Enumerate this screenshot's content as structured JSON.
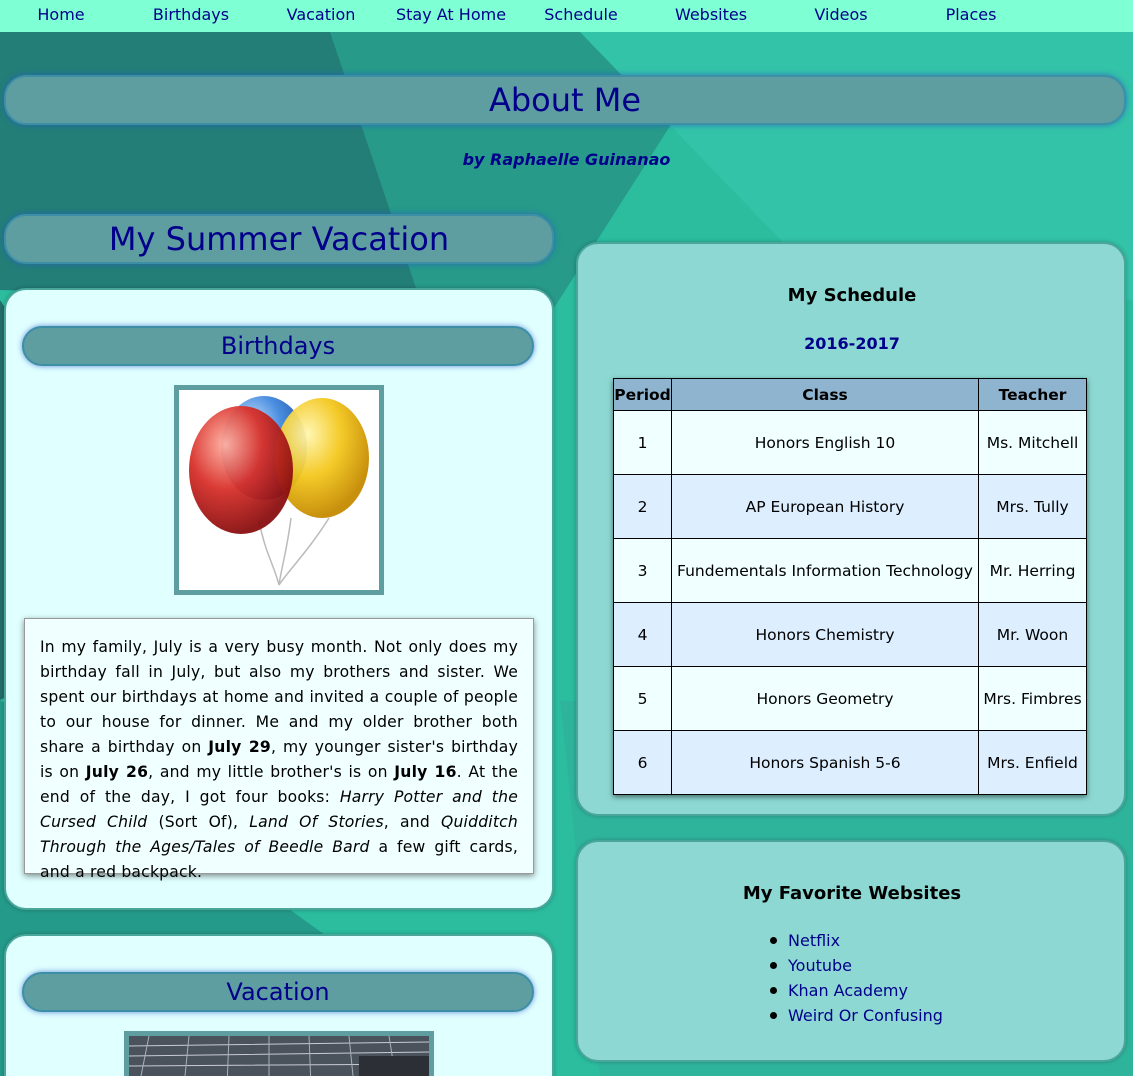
{
  "nav": {
    "items": [
      "Home",
      "Birthdays",
      "Vacation",
      "Stay At Home",
      "Schedule",
      "Websites",
      "Videos",
      "Places"
    ]
  },
  "header": {
    "title": "About Me",
    "byline": "by Raphaelle Guinanao"
  },
  "summer": {
    "title": "My Summer Vacation",
    "birthdays": {
      "heading": "Birthdays",
      "image_icon": "balloons-image"
    },
    "vacation": {
      "heading": "Vacation",
      "image_icon": "vacation-photo"
    }
  },
  "schedule": {
    "title": "My Schedule",
    "year": "2016-2017",
    "headers": [
      "Period",
      "Class",
      "Teacher"
    ],
    "rows": [
      [
        "1",
        "Honors English 10",
        "Ms. Mitchell"
      ],
      [
        "2",
        "AP European History",
        "Mrs. Tully"
      ],
      [
        "3",
        "Fundementals Information Technology",
        "Mr. Herring"
      ],
      [
        "4",
        "Honors Chemistry",
        "Mr. Woon"
      ],
      [
        "5",
        "Honors Geometry",
        "Mrs. Fimbres"
      ],
      [
        "6",
        "Honors Spanish 5-6",
        "Mrs. Enfield"
      ]
    ]
  },
  "websites": {
    "title": "My Favorite Websites",
    "links": [
      "Netflix",
      "Youtube",
      "Khan Academy",
      "Weird Or Confusing"
    ]
  },
  "story": {
    "s1": "In my family, July is a very busy month. Not only does my birthday fall in July, but also my brothers and sister. We spent our birthdays at home and invited a couple of people to our house for dinner. Me and my older brother both share a birthday on ",
    "d1": "July 29",
    "s2": ", my younger sister's birthday is on ",
    "d2": "July 26",
    "s3": ", and my little brother's is on ",
    "d3": "July 16",
    "s4": ". At the end of the day, I got four books: ",
    "b1": "Harry Potter and the Cursed Child",
    "s5": " (Sort Of), ",
    "b2": "Land Of Stories",
    "s6": ", and ",
    "b3": "Quidditch Through the Ages/Tales of Beedle Bard",
    "s7": " a few gift cards, and a red backpack."
  },
  "colors": {
    "nav_bg": "#7fffd4",
    "link": "#00008b",
    "pill": "#5f9ea0",
    "panel_light": "#e0ffff",
    "panel_teal": "#8dd8d2"
  }
}
